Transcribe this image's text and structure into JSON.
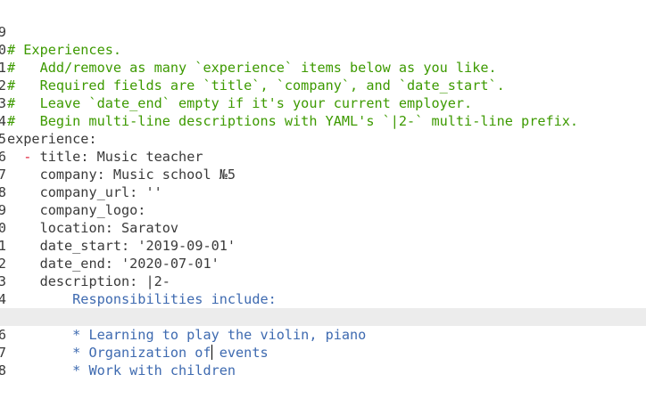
{
  "editor": {
    "language": "yaml",
    "current_line": 16,
    "colors": {
      "comment": "#3d9a00",
      "key": "#3a3a3a",
      "list_dash": "#e0213b",
      "block_text": "#3e6ab0",
      "current_line_bg": "#ececec"
    },
    "lines": [
      {
        "no": "9",
        "indent": "",
        "comment": "# Experiences."
      },
      {
        "no": "0",
        "indent": "",
        "comment": "#   Add/remove as many `experience` items below as you like."
      },
      {
        "no": "1",
        "indent": "",
        "comment": "#   Required fields are `title`, `company`, and `date_start`."
      },
      {
        "no": "2",
        "indent": "",
        "comment": "#   Leave `date_end` empty if it's your current employer."
      },
      {
        "no": "3",
        "indent": "",
        "comment": "#   Begin multi-line descriptions with YAML's `|2-` multi-line prefix."
      },
      {
        "no": "4",
        "indent": "",
        "key": "experience:"
      },
      {
        "no": "5",
        "indent": "  ",
        "dash": "-",
        "key": "title: ",
        "value": "Music teacher"
      },
      {
        "no": "6",
        "indent": "    ",
        "key": "company: ",
        "value": "Music school №5"
      },
      {
        "no": "7",
        "indent": "    ",
        "key": "company_url: ",
        "value": "''"
      },
      {
        "no": "8",
        "indent": "    ",
        "key": "company_logo:",
        "value": ""
      },
      {
        "no": "9",
        "indent": "    ",
        "key": "location: ",
        "value": "Saratov"
      },
      {
        "no": "0",
        "indent": "    ",
        "key": "date_start: ",
        "value": "'2019-09-01'"
      },
      {
        "no": "1",
        "indent": "    ",
        "key": "date_end: ",
        "value": "'2020-07-01'"
      },
      {
        "no": "2",
        "indent": "    ",
        "key": "description: ",
        "value": "|2-"
      },
      {
        "no": "3",
        "indent": "        ",
        "block": "Responsibilities include:"
      },
      {
        "no": "4",
        "indent": "",
        "block": ""
      },
      {
        "no": "5",
        "indent": "        ",
        "block": "* Learning to play the violin, piano"
      },
      {
        "no": "6",
        "indent": "        ",
        "block_before_cursor": "* Organization of",
        "block_after_cursor": " events"
      },
      {
        "no": "7",
        "indent": "        ",
        "block": "* Work with children"
      },
      {
        "no": "8",
        "indent": "",
        "block": ""
      }
    ]
  }
}
